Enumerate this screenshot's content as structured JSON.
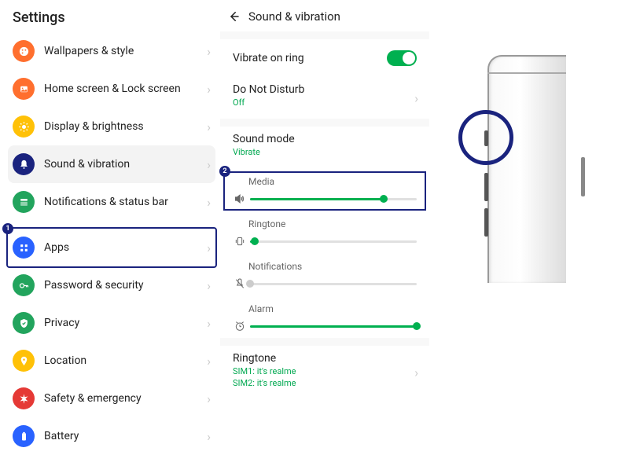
{
  "settings_title": "Settings",
  "settings_items": [
    {
      "label": "Wallpapers & style",
      "color": "#ff6f2e"
    },
    {
      "label": "Home screen & Lock screen",
      "color": "#ff6f2e"
    },
    {
      "label": "Display & brightness",
      "color": "#ffc107"
    },
    {
      "label": "Sound & vibration",
      "color": "#1a237e"
    },
    {
      "label": "Notifications & status bar",
      "color": "#22a45d"
    },
    {
      "label": "Apps",
      "color": "#2962ff"
    },
    {
      "label": "Password & security",
      "color": "#22a45d"
    },
    {
      "label": "Privacy",
      "color": "#22a45d"
    },
    {
      "label": "Location",
      "color": "#ffc107"
    },
    {
      "label": "Safety & emergency",
      "color": "#e53935"
    },
    {
      "label": "Battery",
      "color": "#2962ff"
    }
  ],
  "annot": {
    "badge1": "1",
    "badge2": "2"
  },
  "sv": {
    "title": "Sound & vibration",
    "vibrate_label": "Vibrate on ring",
    "dnd_label": "Do Not Disturb",
    "dnd_value": "Off",
    "mode_label": "Sound mode",
    "mode_value": "Vibrate",
    "sliders": {
      "media": {
        "label": "Media",
        "pct": 80
      },
      "ringtone": {
        "label": "Ringtone",
        "pct": 3
      },
      "notifications": {
        "label": "Notifications",
        "pct": 0
      },
      "alarm": {
        "label": "Alarm",
        "pct": 100
      }
    },
    "ringtone_section": {
      "label": "Ringtone",
      "sim1": "SIM1: it's realme",
      "sim2": "SIM2: it's realme"
    }
  }
}
